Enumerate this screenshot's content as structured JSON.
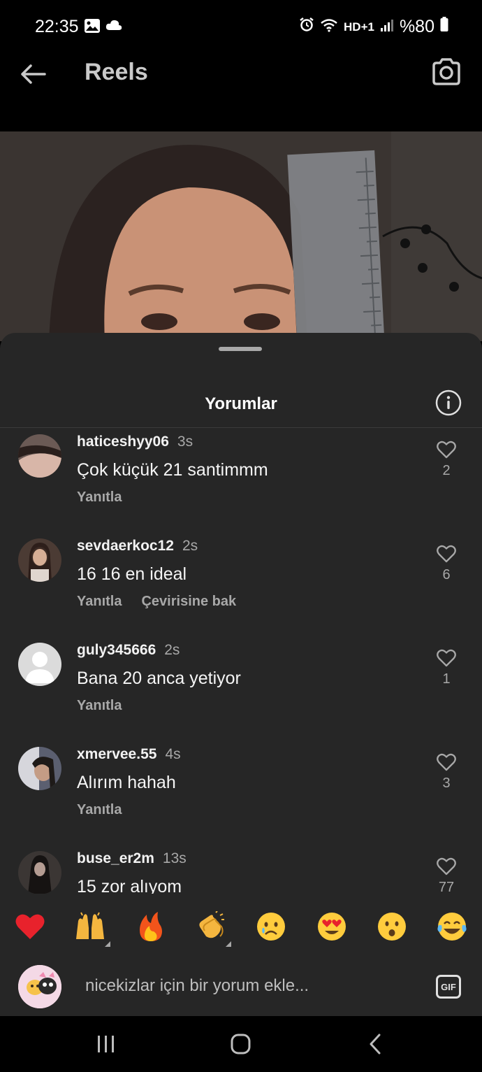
{
  "status_bar": {
    "time": "22:35",
    "signal_text": "HD+1",
    "battery": "%80"
  },
  "header": {
    "title": "Reels"
  },
  "sheet": {
    "title": "Yorumlar"
  },
  "comments": [
    {
      "username": "haticeshyy06",
      "time": "3s",
      "text": "Çok küçük 21 santimmm",
      "reply": "Yanıtla",
      "translate": "",
      "likes": "2",
      "avatar_color": "#6b5a55"
    },
    {
      "username": "sevdaerkoc12",
      "time": "2s",
      "text": "16 16 en ideal",
      "reply": "Yanıtla",
      "translate": "Çevirisine bak",
      "likes": "6",
      "avatar_color": "#4b3b34"
    },
    {
      "username": "guly345666",
      "time": "2s",
      "text": "Bana 20 anca yetiyor",
      "reply": "Yanıtla",
      "translate": "",
      "likes": "1",
      "avatar_color": "#dbdbdb"
    },
    {
      "username": "xmervee.55",
      "time": "4s",
      "text": "Alırım hahah",
      "reply": "Yanıtla",
      "translate": "",
      "likes": "3",
      "avatar_color": "#5b5f70"
    },
    {
      "username": "buse_er2m",
      "time": "13s",
      "text": "15 zor alıyom",
      "reply": "",
      "translate": "",
      "likes": "77",
      "avatar_color": "#3b3634"
    }
  ],
  "emoji_bar": {
    "emojis": [
      "red-heart",
      "raising-hands",
      "fire",
      "clapping-hands",
      "crying-face",
      "heart-eyes",
      "surprised-face",
      "tears-of-joy"
    ]
  },
  "input": {
    "placeholder": "nicekizlar için bir yorum ekle...",
    "gif_label": "GIF"
  },
  "colors": {
    "sheet_bg": "#262626",
    "secondary_text": "#a8a8a8",
    "heart_red": "#e8222c"
  }
}
